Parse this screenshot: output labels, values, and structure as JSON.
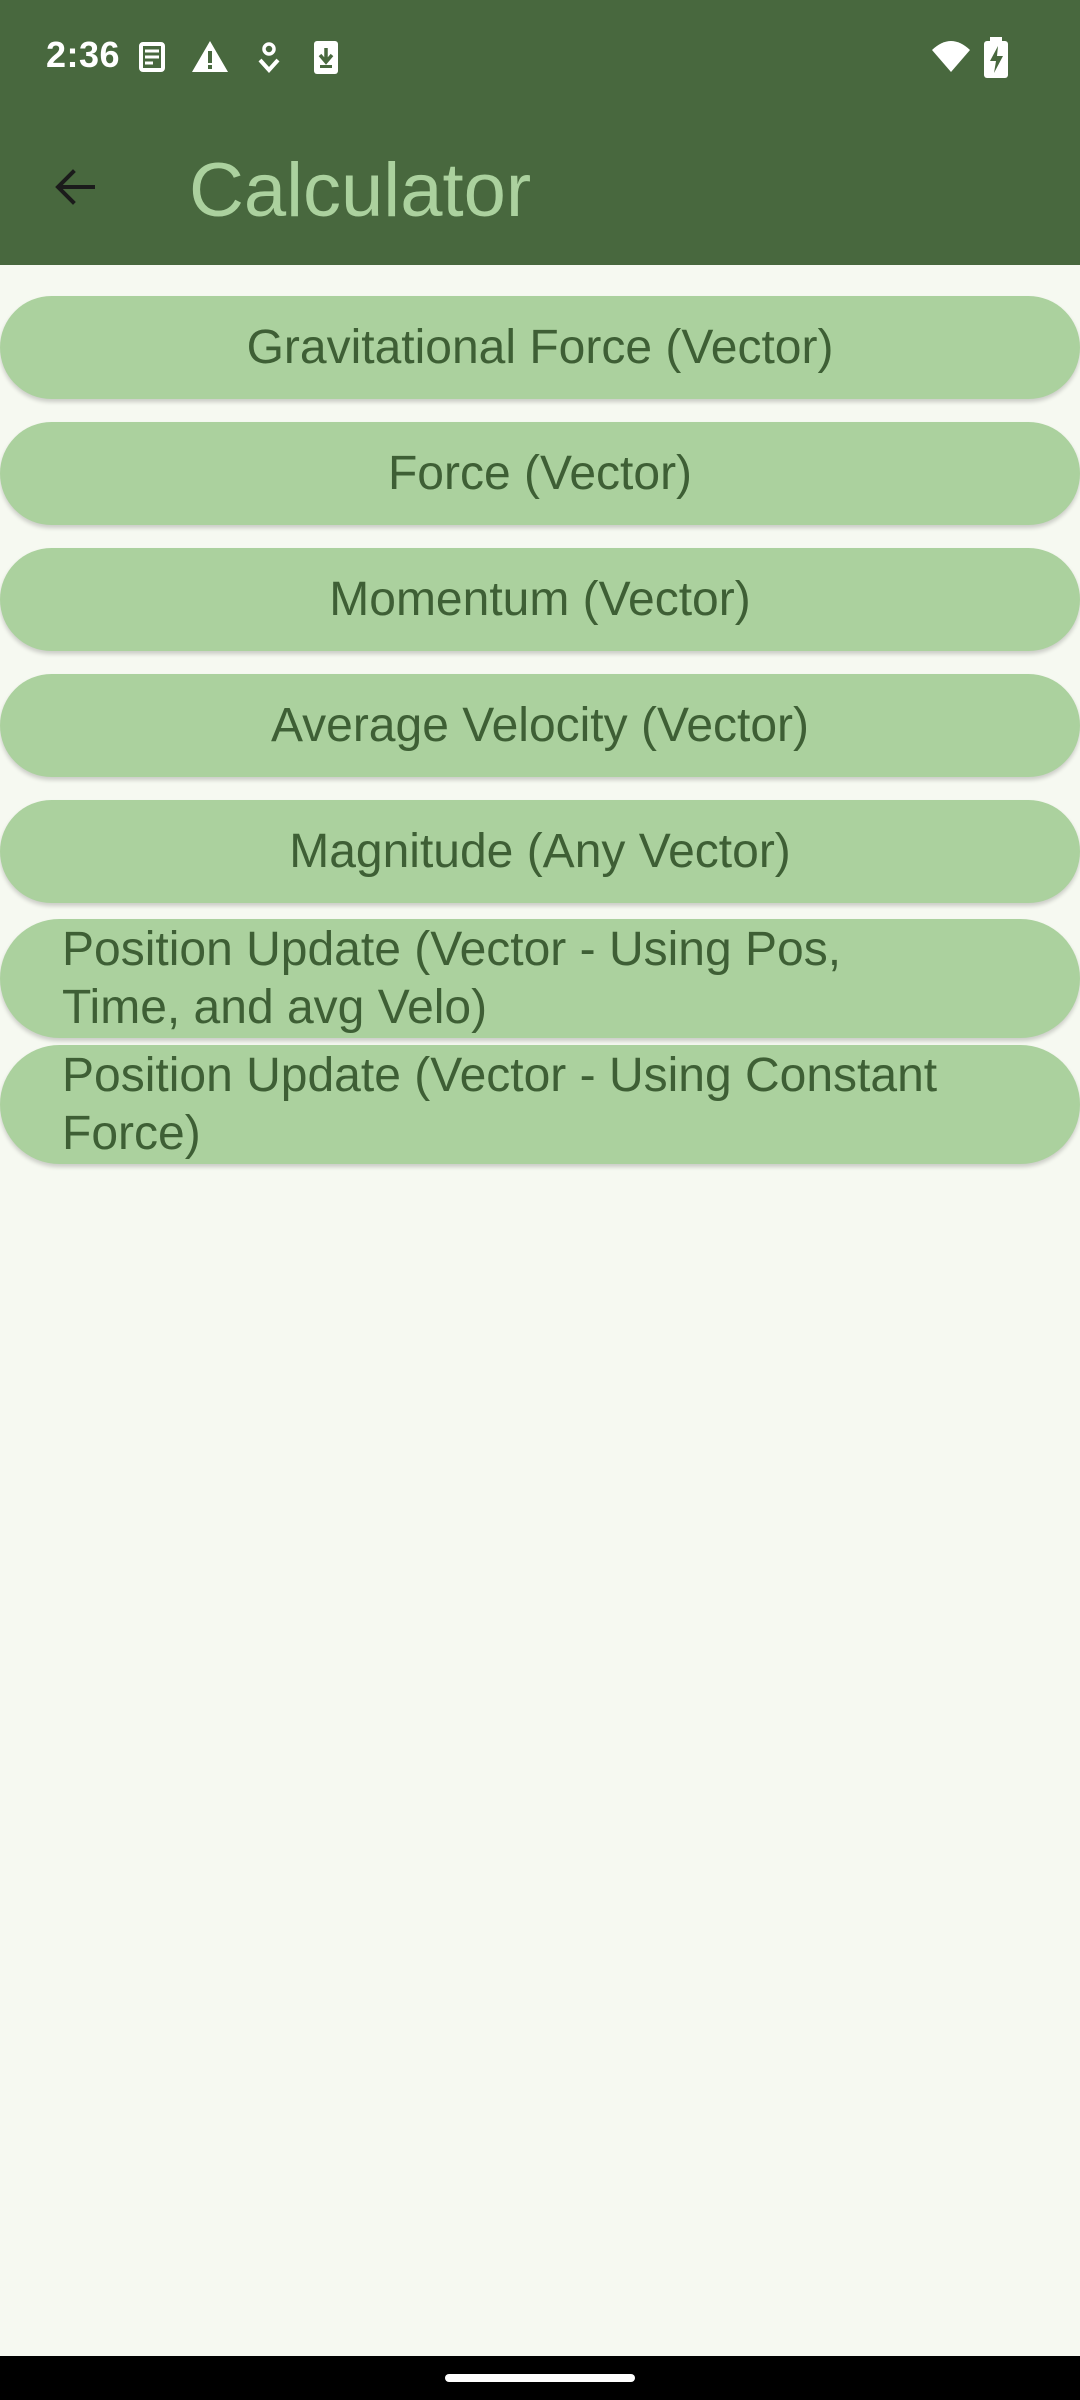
{
  "status_bar": {
    "time": "2:36",
    "icons_left": [
      "keyboard-icon",
      "alert-icon",
      "location-shield-icon",
      "download-icon"
    ],
    "icons_right": [
      "wifi-icon",
      "battery-charging-icon"
    ],
    "background_color": "#48683e"
  },
  "app_bar": {
    "title": "Calculator",
    "back_icon": "arrow-back-icon",
    "title_color": "#abd19e"
  },
  "buttons": [
    {
      "label": "Gravitational Force (Vector)"
    },
    {
      "label": "Force (Vector)"
    },
    {
      "label": "Momentum (Vector)"
    },
    {
      "label": "Average Velocity (Vector)"
    },
    {
      "label": "Magnitude (Any Vector)"
    },
    {
      "label": "Position Update (Vector - Using Pos, Time, and avg Velo)"
    },
    {
      "label": "Position Update (Vector - Using Constant Force)"
    }
  ],
  "colors": {
    "button_background": "#abd19e",
    "button_text": "#3e5f35",
    "page_background": "#f6f9f1"
  }
}
